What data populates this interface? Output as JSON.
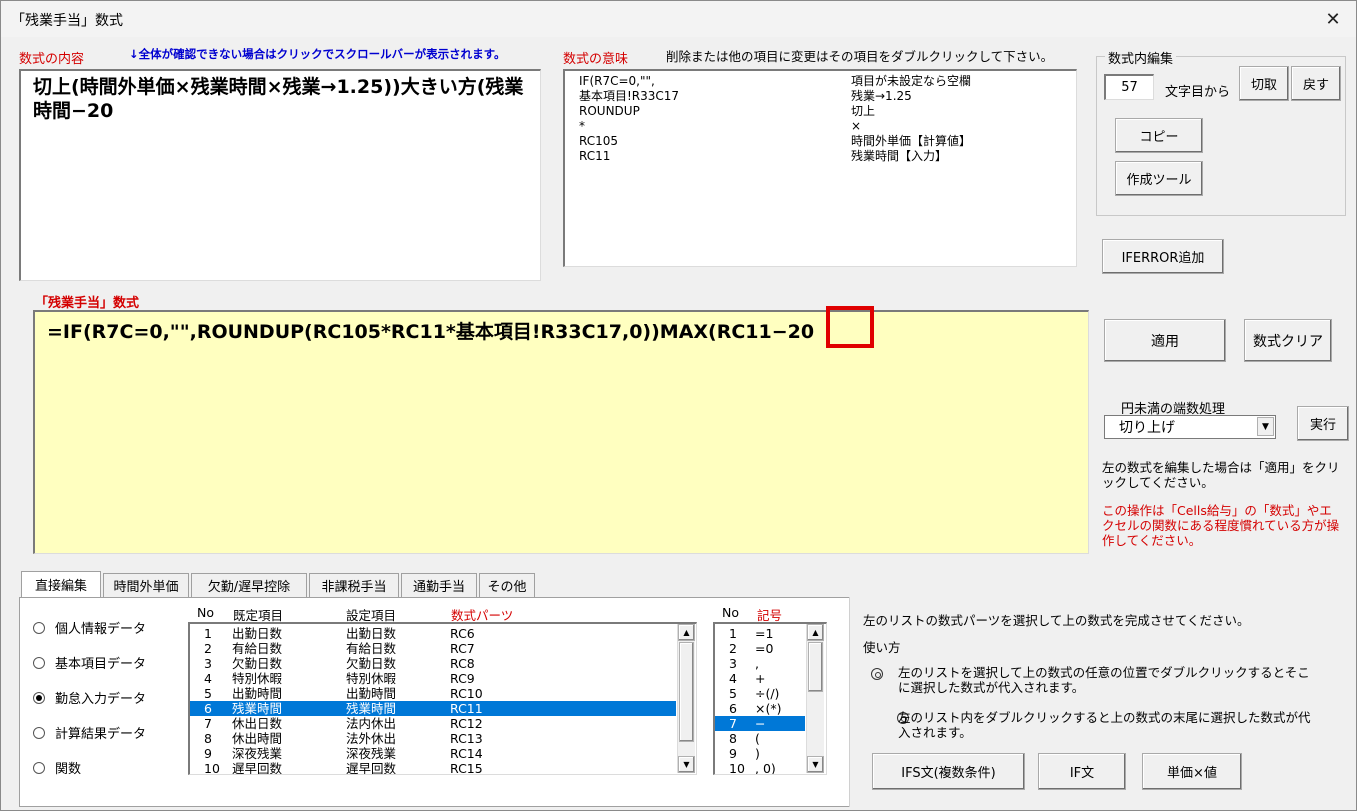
{
  "window": {
    "title": "「残業手当」数式",
    "close_label": "✕"
  },
  "formula_content": {
    "label": "数式の内容",
    "hint": "↓全体が確認できない場合はクリックでスクロールバーが表示されます。",
    "text": "切上(時間外単価×残業時間×残業→1.25))大きい方(残業時間−20"
  },
  "meaning": {
    "label": "数式の意味",
    "hint": "削除または他の項目に変更はその項目をダブルクリックして下さい。",
    "rows": [
      {
        "part": "IF(R7C=0,\"\",",
        "desc": "項目が未設定なら空欄"
      },
      {
        "part": "基本項目!R33C17",
        "desc": "残業→1.25"
      },
      {
        "part": "ROUNDUP",
        "desc": "切上"
      },
      {
        "part": "*",
        "desc": "×"
      },
      {
        "part": "RC105",
        "desc": "時間外単価【計算値】"
      },
      {
        "part": "RC11",
        "desc": "残業時間【入力】"
      }
    ]
  },
  "edit_group": {
    "title": "数式内編集",
    "position_value": "57",
    "position_suffix": "文字目から",
    "cut_label": "切取",
    "undo_label": "戻す",
    "copy_label": "コピー",
    "tool_label": "作成ツール"
  },
  "iferror_label": "IFERROR追加",
  "main_formula": {
    "label": "「残業手当」数式",
    "text_before": "=IF(R7C=0,\"\",ROUNDUP(RC105*RC11*基本項目!R33C17,0))MAX(RC11−",
    "text_highlight": "20"
  },
  "apply_label": "適用",
  "clear_label": "数式クリア",
  "rounding": {
    "label": "円未満の端数処理",
    "selected": "切り上げ",
    "run_label": "実行"
  },
  "notes": {
    "apply_note": "左の数式を編集した場合は「適用」をクリックしてください。",
    "warning": "この操作は「Cells給与」の「数式」やエクセルの関数にある程度慣れている方が操作してください。"
  },
  "tabs": [
    "直接編集",
    "時間外単価",
    "欠勤/遅早控除",
    "非課税手当",
    "通勤手当",
    "その他"
  ],
  "radio_options": [
    {
      "label": "個人情報データ",
      "checked": false
    },
    {
      "label": "基本項目データ",
      "checked": false
    },
    {
      "label": "勤怠入力データ",
      "checked": true
    },
    {
      "label": "計算結果データ",
      "checked": false
    },
    {
      "label": "関数",
      "checked": false
    }
  ],
  "parts_list": {
    "headers": {
      "no": "No",
      "default": "既定項目",
      "setting": "設定項目",
      "parts": "数式パーツ"
    },
    "rows": [
      {
        "no": "1",
        "default": "出勤日数",
        "setting": "出勤日数",
        "parts": "RC6"
      },
      {
        "no": "2",
        "default": "有給日数",
        "setting": "有給日数",
        "parts": "RC7"
      },
      {
        "no": "3",
        "default": "欠勤日数",
        "setting": "欠勤日数",
        "parts": "RC8"
      },
      {
        "no": "4",
        "default": "特別休暇",
        "setting": "特別休暇",
        "parts": "RC9"
      },
      {
        "no": "5",
        "default": "出勤時間",
        "setting": "出勤時間",
        "parts": "RC10"
      },
      {
        "no": "6",
        "default": "残業時間",
        "setting": "残業時間",
        "parts": "RC11"
      },
      {
        "no": "7",
        "default": "休出日数",
        "setting": "法内休出",
        "parts": "RC12"
      },
      {
        "no": "8",
        "default": "休出時間",
        "setting": "法外休出",
        "parts": "RC13"
      },
      {
        "no": "9",
        "default": "深夜残業",
        "setting": "深夜残業",
        "parts": "RC14"
      },
      {
        "no": "10",
        "default": "遅早回数",
        "setting": "遅早回数",
        "parts": "RC15"
      }
    ],
    "selected_index": 5
  },
  "symbol_list": {
    "headers": {
      "no": "No",
      "symbol": "記号"
    },
    "rows": [
      {
        "no": "1",
        "symbol": "=1"
      },
      {
        "no": "2",
        "symbol": "=0"
      },
      {
        "no": "3",
        "symbol": ","
      },
      {
        "no": "4",
        "symbol": "+"
      },
      {
        "no": "5",
        "symbol": "÷(/)"
      },
      {
        "no": "6",
        "symbol": "×(*)"
      },
      {
        "no": "7",
        "symbol": "−"
      },
      {
        "no": "8",
        "symbol": "("
      },
      {
        "no": "9",
        "symbol": ")"
      },
      {
        "no": "10",
        "symbol": ", 0)"
      }
    ],
    "selected_index": 6
  },
  "help": {
    "intro": "左のリストの数式パーツを選択して上の数式を完成させてください。",
    "usage_title": "使い方",
    "item1": "左のリストを選択して上の数式の任意の位置でダブルクリックするとそこに選択した数式が代入されます。",
    "item2": "左のリスト内をダブルクリックすると上の数式の末尾に選択した数式が代入されます。"
  },
  "bottom_buttons": {
    "ifs_label": "IFS文(複数条件)",
    "if_label": "IF文",
    "unit_label": "単価×値"
  },
  "colors": {
    "accent_red": "#d40000",
    "hint_blue": "#0000d0",
    "formula_bg": "#ffffc0",
    "selection": "#0078d7"
  }
}
